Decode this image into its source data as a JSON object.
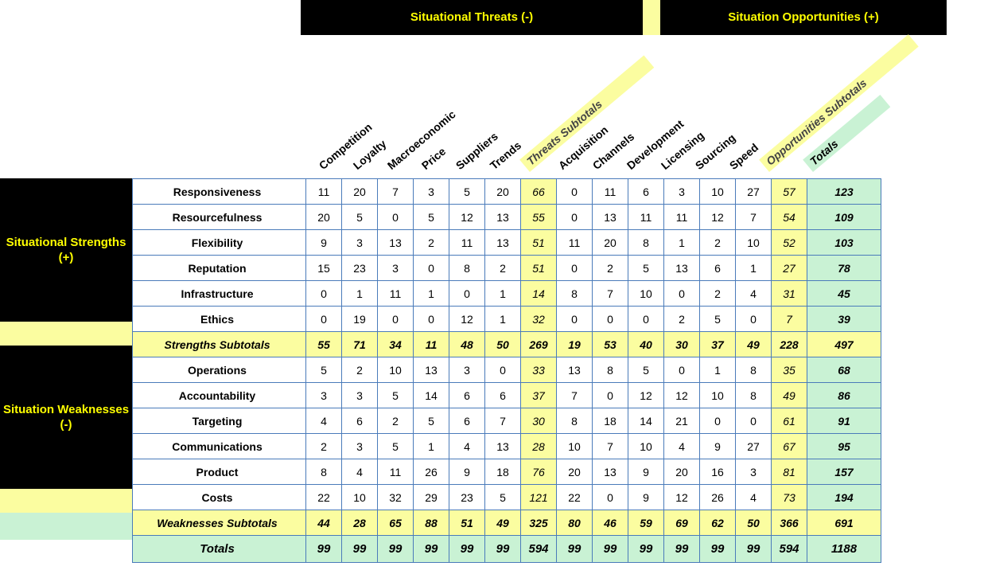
{
  "top": {
    "threats": "Situational Threats (-)",
    "opportunities": "Situation Opportunities (+)"
  },
  "left": {
    "strengths": "Situational Strengths (+)",
    "weaknesses": "Situation Weaknesses (-)"
  },
  "cols": {
    "c0": "Competition",
    "c1": "Loyalty",
    "c2": "Macroeconomic",
    "c3": "Price",
    "c4": "Suppliers",
    "c5": "Trends",
    "threats_sub": "Threats Subtotals",
    "c6": "Acquisition",
    "c7": "Channels",
    "c8": "Development",
    "c9": "Licensing",
    "c10": "Sourcing",
    "c11": "Speed",
    "opp_sub": "Opportunities Subtotals",
    "totals": "Totals"
  },
  "rows": [
    {
      "name": "Responsiveness",
      "v": [
        11,
        20,
        7,
        3,
        5,
        20
      ],
      "ts": 66,
      "w": [
        0,
        11,
        6,
        3,
        10,
        27
      ],
      "os": 57,
      "t": 123
    },
    {
      "name": "Resourcefulness",
      "v": [
        20,
        5,
        0,
        5,
        12,
        13
      ],
      "ts": 55,
      "w": [
        0,
        13,
        11,
        11,
        12,
        7
      ],
      "os": 54,
      "t": 109
    },
    {
      "name": "Flexibility",
      "v": [
        9,
        3,
        13,
        2,
        11,
        13
      ],
      "ts": 51,
      "w": [
        11,
        20,
        8,
        1,
        2,
        10
      ],
      "os": 52,
      "t": 103
    },
    {
      "name": "Reputation",
      "v": [
        15,
        23,
        3,
        0,
        8,
        2
      ],
      "ts": 51,
      "w": [
        0,
        2,
        5,
        13,
        6,
        1
      ],
      "os": 27,
      "t": 78
    },
    {
      "name": "Infrastructure",
      "v": [
        0,
        1,
        11,
        1,
        0,
        1
      ],
      "ts": 14,
      "w": [
        8,
        7,
        10,
        0,
        2,
        4
      ],
      "os": 31,
      "t": 45
    },
    {
      "name": "Ethics",
      "v": [
        0,
        19,
        0,
        0,
        12,
        1
      ],
      "ts": 32,
      "w": [
        0,
        0,
        0,
        2,
        5,
        0
      ],
      "os": 7,
      "t": 39
    }
  ],
  "strengths_sub": {
    "name": "Strengths Subtotals",
    "v": [
      55,
      71,
      34,
      11,
      48,
      50
    ],
    "ts": 269,
    "w": [
      19,
      53,
      40,
      30,
      37,
      49
    ],
    "os": 228,
    "t": 497
  },
  "wrows": [
    {
      "name": "Operations",
      "v": [
        5,
        2,
        10,
        13,
        3,
        0
      ],
      "ts": 33,
      "w": [
        13,
        8,
        5,
        0,
        1,
        8
      ],
      "os": 35,
      "t": 68
    },
    {
      "name": "Accountability",
      "v": [
        3,
        3,
        5,
        14,
        6,
        6
      ],
      "ts": 37,
      "w": [
        7,
        0,
        12,
        12,
        10,
        8
      ],
      "os": 49,
      "t": 86
    },
    {
      "name": "Targeting",
      "v": [
        4,
        6,
        2,
        5,
        6,
        7
      ],
      "ts": 30,
      "w": [
        8,
        18,
        14,
        21,
        0,
        0
      ],
      "os": 61,
      "t": 91
    },
    {
      "name": "Communications",
      "v": [
        2,
        3,
        5,
        1,
        4,
        13
      ],
      "ts": 28,
      "w": [
        10,
        7,
        10,
        4,
        9,
        27
      ],
      "os": 67,
      "t": 95
    },
    {
      "name": "Product",
      "v": [
        8,
        4,
        11,
        26,
        9,
        18
      ],
      "ts": 76,
      "w": [
        20,
        13,
        9,
        20,
        16,
        3
      ],
      "os": 81,
      "t": 157
    },
    {
      "name": "Costs",
      "v": [
        22,
        10,
        32,
        29,
        23,
        5
      ],
      "ts": 121,
      "w": [
        22,
        0,
        9,
        12,
        26,
        4
      ],
      "os": 73,
      "t": 194
    }
  ],
  "weak_sub": {
    "name": "Weaknesses Subtotals",
    "v": [
      44,
      28,
      65,
      88,
      51,
      49
    ],
    "ts": 325,
    "w": [
      80,
      46,
      59,
      69,
      62,
      50
    ],
    "os": 366,
    "t": 691
  },
  "totals": {
    "name": "Totals",
    "v": [
      99,
      99,
      99,
      99,
      99,
      99
    ],
    "ts": 594,
    "w": [
      99,
      99,
      99,
      99,
      99,
      99
    ],
    "os": 594,
    "t": 1188
  },
  "chart_data": {
    "type": "table",
    "title": "SWOT cross-analysis matrix",
    "column_groups": [
      "Situational Threats (-)",
      "Situation Opportunities (+)"
    ],
    "columns": [
      "Competition",
      "Loyalty",
      "Macroeconomic",
      "Price",
      "Suppliers",
      "Trends",
      "Threats Subtotals",
      "Acquisition",
      "Channels",
      "Development",
      "Licensing",
      "Sourcing",
      "Speed",
      "Opportunities Subtotals",
      "Totals"
    ],
    "row_groups": [
      "Situational Strengths (+)",
      "Situation Weaknesses (-)"
    ],
    "rows": [
      "Responsiveness",
      "Resourcefulness",
      "Flexibility",
      "Reputation",
      "Infrastructure",
      "Ethics",
      "Strengths Subtotals",
      "Operations",
      "Accountability",
      "Targeting",
      "Communications",
      "Product",
      "Costs",
      "Weaknesses Subtotals",
      "Totals"
    ],
    "data": [
      [
        11,
        20,
        7,
        3,
        5,
        20,
        66,
        0,
        11,
        6,
        3,
        10,
        27,
        57,
        123
      ],
      [
        20,
        5,
        0,
        5,
        12,
        13,
        55,
        0,
        13,
        11,
        11,
        12,
        7,
        54,
        109
      ],
      [
        9,
        3,
        13,
        2,
        11,
        13,
        51,
        11,
        20,
        8,
        1,
        2,
        10,
        52,
        103
      ],
      [
        15,
        23,
        3,
        0,
        8,
        2,
        51,
        0,
        2,
        5,
        13,
        6,
        1,
        27,
        78
      ],
      [
        0,
        1,
        11,
        1,
        0,
        1,
        14,
        8,
        7,
        10,
        0,
        2,
        4,
        31,
        45
      ],
      [
        0,
        19,
        0,
        0,
        12,
        1,
        32,
        0,
        0,
        0,
        2,
        5,
        0,
        7,
        39
      ],
      [
        55,
        71,
        34,
        11,
        48,
        50,
        269,
        19,
        53,
        40,
        30,
        37,
        49,
        228,
        497
      ],
      [
        5,
        2,
        10,
        13,
        3,
        0,
        33,
        13,
        8,
        5,
        0,
        1,
        8,
        35,
        68
      ],
      [
        3,
        3,
        5,
        14,
        6,
        6,
        37,
        7,
        0,
        12,
        12,
        10,
        8,
        49,
        86
      ],
      [
        4,
        6,
        2,
        5,
        6,
        7,
        30,
        8,
        18,
        14,
        21,
        0,
        0,
        61,
        91
      ],
      [
        2,
        3,
        5,
        1,
        4,
        13,
        28,
        10,
        7,
        10,
        4,
        9,
        27,
        67,
        95
      ],
      [
        8,
        4,
        11,
        26,
        9,
        18,
        76,
        20,
        13,
        9,
        20,
        16,
        3,
        81,
        157
      ],
      [
        22,
        10,
        32,
        29,
        23,
        5,
        121,
        22,
        0,
        9,
        12,
        26,
        4,
        73,
        194
      ],
      [
        44,
        28,
        65,
        88,
        51,
        49,
        325,
        80,
        46,
        59,
        69,
        62,
        50,
        366,
        691
      ],
      [
        99,
        99,
        99,
        99,
        99,
        99,
        594,
        99,
        99,
        99,
        99,
        99,
        99,
        594,
        1188
      ]
    ]
  }
}
